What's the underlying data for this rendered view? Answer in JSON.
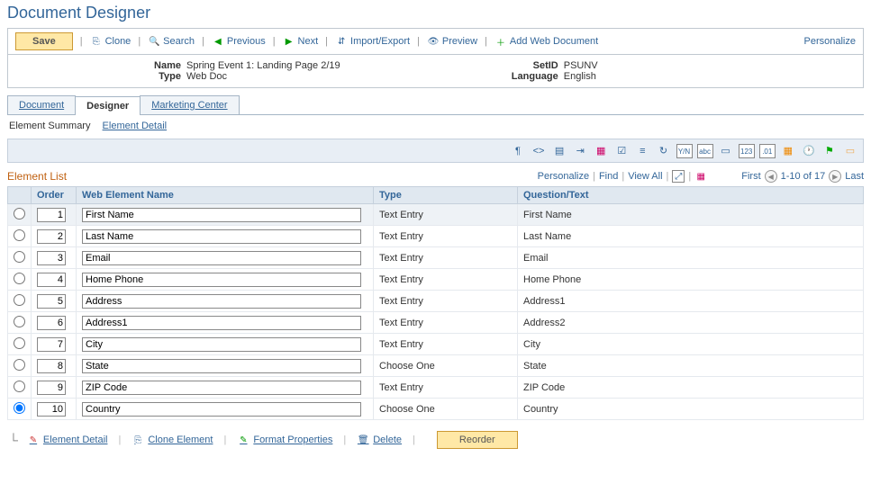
{
  "page_title": "Document Designer",
  "toolbar": {
    "save": "Save",
    "clone": "Clone",
    "search": "Search",
    "previous": "Previous",
    "next": "Next",
    "import_export": "Import/Export",
    "preview": "Preview",
    "add_web_doc": "Add Web Document",
    "personalize": "Personalize"
  },
  "info": {
    "name_label": "Name",
    "name_value": "Spring Event 1: Landing Page 2/19",
    "type_label": "Type",
    "type_value": "Web Doc",
    "setid_label": "SetID",
    "setid_value": "PSUNV",
    "language_label": "Language",
    "language_value": "English"
  },
  "tabs": {
    "document": "Document",
    "designer": "Designer",
    "marketing_center": "Marketing Center"
  },
  "subnav": {
    "summary": "Element Summary",
    "detail": "Element Detail"
  },
  "element_list": {
    "title": "Element List",
    "personalize": "Personalize",
    "find": "Find",
    "view_all": "View All",
    "first": "First",
    "range": "1-10 of 17",
    "last": "Last",
    "headers": {
      "order": "Order",
      "name": "Web Element Name",
      "type": "Type",
      "question": "Question/Text"
    },
    "rows": [
      {
        "order": "1",
        "name": "First Name",
        "type": "Text Entry",
        "question": "First Name",
        "selected": false,
        "highlighted": true
      },
      {
        "order": "2",
        "name": "Last Name",
        "type": "Text Entry",
        "question": "Last Name",
        "selected": false,
        "highlighted": false
      },
      {
        "order": "3",
        "name": "Email",
        "type": "Text Entry",
        "question": "Email",
        "selected": false,
        "highlighted": false
      },
      {
        "order": "4",
        "name": "Home Phone",
        "type": "Text Entry",
        "question": "Home Phone",
        "selected": false,
        "highlighted": false
      },
      {
        "order": "5",
        "name": "Address",
        "type": "Text Entry",
        "question": "Address1",
        "selected": false,
        "highlighted": false
      },
      {
        "order": "6",
        "name": "Address1",
        "type": "Text Entry",
        "question": "Address2",
        "selected": false,
        "highlighted": false
      },
      {
        "order": "7",
        "name": "City",
        "type": "Text Entry",
        "question": "City",
        "selected": false,
        "highlighted": false
      },
      {
        "order": "8",
        "name": "State",
        "type": "Choose One",
        "question": "State",
        "selected": false,
        "highlighted": false
      },
      {
        "order": "9",
        "name": "ZIP Code",
        "type": "Text Entry",
        "question": "ZIP Code",
        "selected": false,
        "highlighted": false
      },
      {
        "order": "10",
        "name": "Country",
        "type": "Choose One",
        "question": "Country",
        "selected": true,
        "highlighted": false
      }
    ]
  },
  "footer": {
    "element_detail": "Element Detail",
    "clone_element": "Clone Element",
    "format_properties": "Format Properties",
    "delete": "Delete",
    "reorder": "Reorder"
  }
}
